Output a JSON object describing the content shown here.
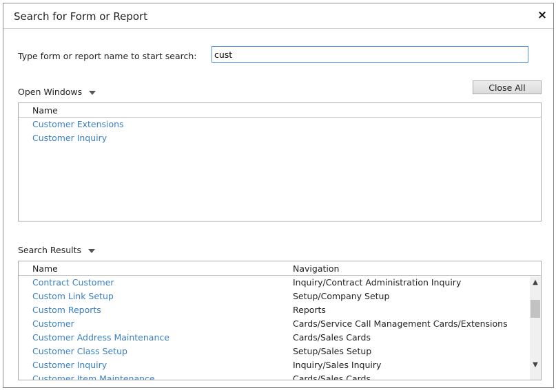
{
  "dialog": {
    "title": "Search for Form or Report",
    "close_glyph": "×"
  },
  "search": {
    "label": "Type form or report name to start search:",
    "value": "cust"
  },
  "open_windows": {
    "label": "Open Windows",
    "close_all_label": "Close All",
    "column_name": "Name",
    "items": [
      "Customer Extensions",
      "Customer Inquiry"
    ]
  },
  "search_results": {
    "label": "Search Results",
    "column_name": "Name",
    "column_navigation": "Navigation",
    "rows": [
      {
        "name": "Contract Customer",
        "navigation": "Inquiry/Contract Administration Inquiry"
      },
      {
        "name": "Custom Link Setup",
        "navigation": "Setup/Company Setup"
      },
      {
        "name": "Custom Reports",
        "navigation": "Reports"
      },
      {
        "name": "Customer",
        "navigation": "Cards/Service Call Management Cards/Extensions"
      },
      {
        "name": "Customer Address Maintenance",
        "navigation": "Cards/Sales Cards"
      },
      {
        "name": "Customer Class Setup",
        "navigation": "Setup/Sales Setup"
      },
      {
        "name": "Customer Inquiry",
        "navigation": "Inquiry/Sales Inquiry"
      },
      {
        "name": "Customer Item Maintenance",
        "navigation": "Cards/Sales Cards"
      }
    ]
  },
  "icons": {
    "close": "close-icon",
    "dropdown": "chevron-down-icon",
    "scroll_up": "chevron-up-icon",
    "scroll_down": "chevron-down-icon"
  },
  "colors": {
    "link": "#3a7fc1",
    "input_border": "#4a90d9"
  }
}
